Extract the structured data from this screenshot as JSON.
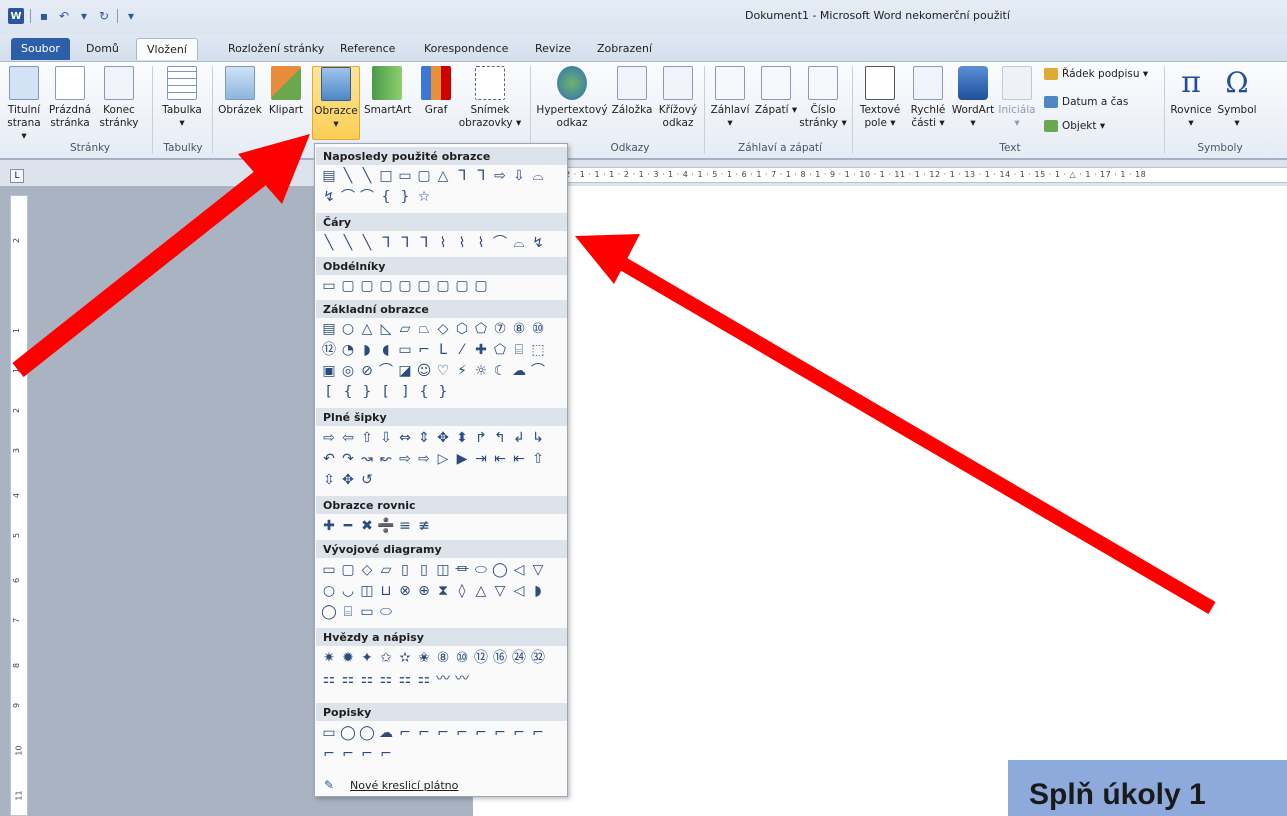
{
  "title_bar": {
    "title": "Dokument1 - Microsoft Word nekomerční použití"
  },
  "tabs": [
    {
      "label": "Soubor"
    },
    {
      "label": "Domů"
    },
    {
      "label": "Vložení"
    },
    {
      "label": "Rozložení stránky"
    },
    {
      "label": "Reference"
    },
    {
      "label": "Korespondence"
    },
    {
      "label": "Revize"
    },
    {
      "label": "Zobrazení"
    }
  ],
  "ribbon": {
    "titulni": "Titulní strana ▾",
    "prazdna": "Prázdná stránka",
    "konec": "Konec stránky",
    "tabulka": "Tabulka ▾",
    "obrazek": "Obrázek",
    "klipart": "Klipart",
    "obrazce": "Obrazce ▾",
    "smartart": "SmartArt",
    "graf": "Graf",
    "snimek": "Snímek obrazovky ▾",
    "hypertext": "Hypertextový odkaz",
    "zalozka": "Záložka",
    "krizovy": "Křížový odkaz",
    "zahlavi": "Záhlaví ▾",
    "zapati": "Zápatí ▾",
    "cislo": "Číslo stránky ▾",
    "textove": "Textové pole ▾",
    "rychle": "Rychlé části ▾",
    "wordart": "WordArt ▾",
    "inicialka": "Iniciála ▾",
    "radek_podpisu": "Řádek podpisu ▾",
    "datum": "Datum a čas",
    "objekt": "Objekt ▾",
    "rovnice": "Rovnice ▾",
    "symbol": "Symbol ▾",
    "groups": {
      "stranky": "Stránky",
      "tabulky": "Tabulky",
      "odkazy": "Odkazy",
      "zahlavi_zapati": "Záhlaví a zápatí",
      "text": "Text",
      "symboly": "Symboly"
    }
  },
  "ruler": {
    "top": "2 · 1 · 1 · 1 · 2 · 1 · 3 · 1 · 4 · 1 · 5 · 1 · 6 · 1 · 7 · 1 · 8 · 1 · 9 · 1 · 10 · 1 · 11 · 1 · 12 · 1 · 13 · 1 · 14 · 1 · 15 · 1 · △ · 1 · 17 · 1 · 18",
    "corner": "L",
    "left_numbers": [
      "2",
      "1",
      "1",
      "2",
      "3",
      "4",
      "5",
      "6",
      "7",
      "8",
      "9",
      "10",
      "11"
    ]
  },
  "shapes_menu": {
    "sections": [
      {
        "title": "Naposledy použité obrazce",
        "rows": [
          [
            "▤",
            "╲",
            "╲",
            "□",
            "▭",
            "▢",
            "△",
            "ᒣ",
            "ᒣ",
            "⇨",
            "⇩",
            "⌓"
          ],
          [
            "↯",
            "⌒",
            "⌒",
            "{",
            "}",
            "☆"
          ]
        ]
      },
      {
        "title": "Čáry",
        "rows": [
          [
            "╲",
            "╲",
            "╲",
            "ᒣ",
            "ᒣ",
            "ᒣ",
            "⌇",
            "⌇",
            "⌇",
            "⌒",
            "⌓",
            "↯"
          ]
        ]
      },
      {
        "title": "Obdélníky",
        "rows": [
          [
            "▭",
            "▢",
            "▢",
            "▢",
            "▢",
            "▢",
            "▢",
            "▢",
            "▢"
          ]
        ]
      },
      {
        "title": "Základní obrazce",
        "rows": [
          [
            "▤",
            "○",
            "△",
            "◺",
            "▱",
            "⏢",
            "◇",
            "⬡",
            "⬠",
            "⑦",
            "⑧",
            "⑩"
          ],
          [
            "⑫",
            "◔",
            "◗",
            "◖",
            "▭",
            "⌐",
            "ᒪ",
            "⁄",
            "✚",
            "⬠",
            "⌸",
            "⬚"
          ],
          [
            "▣",
            "◎",
            "⊘",
            "⌒",
            "◪",
            "☺",
            "♡",
            "⚡",
            "☼",
            "☾",
            "☁",
            "⌒"
          ],
          [
            "[",
            "{",
            "}",
            "[",
            "]",
            "{",
            "}"
          ]
        ]
      },
      {
        "title": "Plné šipky",
        "rows": [
          [
            "⇨",
            "⇦",
            "⇧",
            "⇩",
            "⇔",
            "⇕",
            "✥",
            "⬍",
            "↱",
            "↰",
            "↲",
            "↳"
          ],
          [
            "↶",
            "↷",
            "↝",
            "↜",
            "⇨",
            "⇨",
            "▷",
            "▶",
            "⇥",
            "⇤",
            "⇤",
            "⇧"
          ],
          [
            "⇳",
            "✥",
            "↺"
          ]
        ]
      },
      {
        "title": "Obrazce rovnic",
        "rows": [
          [
            "✚",
            "━",
            "✖",
            "➗",
            "≡",
            "≢"
          ]
        ]
      },
      {
        "title": "Vývojové diagramy",
        "rows": [
          [
            "▭",
            "▢",
            "◇",
            "▱",
            "▯",
            "▯",
            "◫",
            "⏛",
            "⬭",
            "◯",
            "◁",
            "▽"
          ],
          [
            "○",
            "◡",
            "◫",
            "⊔",
            "⊗",
            "⊕",
            "⧗",
            "◊",
            "△",
            "▽",
            "◁",
            "◗"
          ],
          [
            "◯",
            "⌸",
            "▭",
            "⬭"
          ]
        ]
      },
      {
        "title": "Hvězdy a nápisy",
        "rows": [
          [
            "✷",
            "✹",
            "✦",
            "✩",
            "✫",
            "✬",
            "⑧",
            "⑩",
            "⑫",
            "⑯",
            "㉔",
            "㉜"
          ],
          [
            "⚏",
            "⚏",
            "⚏",
            "⚏",
            "⚏",
            "⚏",
            "〰",
            "〰"
          ]
        ]
      },
      {
        "title": "Popisky",
        "rows": [
          [
            "▭",
            "◯",
            "◯",
            "☁",
            "⌐",
            "⌐",
            "⌐",
            "⌐",
            "⌐",
            "⌐",
            "⌐",
            "⌐"
          ],
          [
            "⌐",
            "⌐",
            "⌐",
            "⌐"
          ]
        ]
      }
    ],
    "footer": "Nové kreslicí plátno"
  },
  "document": {
    "task_text": "Splň úkoly 1"
  },
  "colors": {
    "file_tab": "#2d5ea8",
    "arrow": "#ff0000",
    "task_box": "#8ea9db"
  }
}
